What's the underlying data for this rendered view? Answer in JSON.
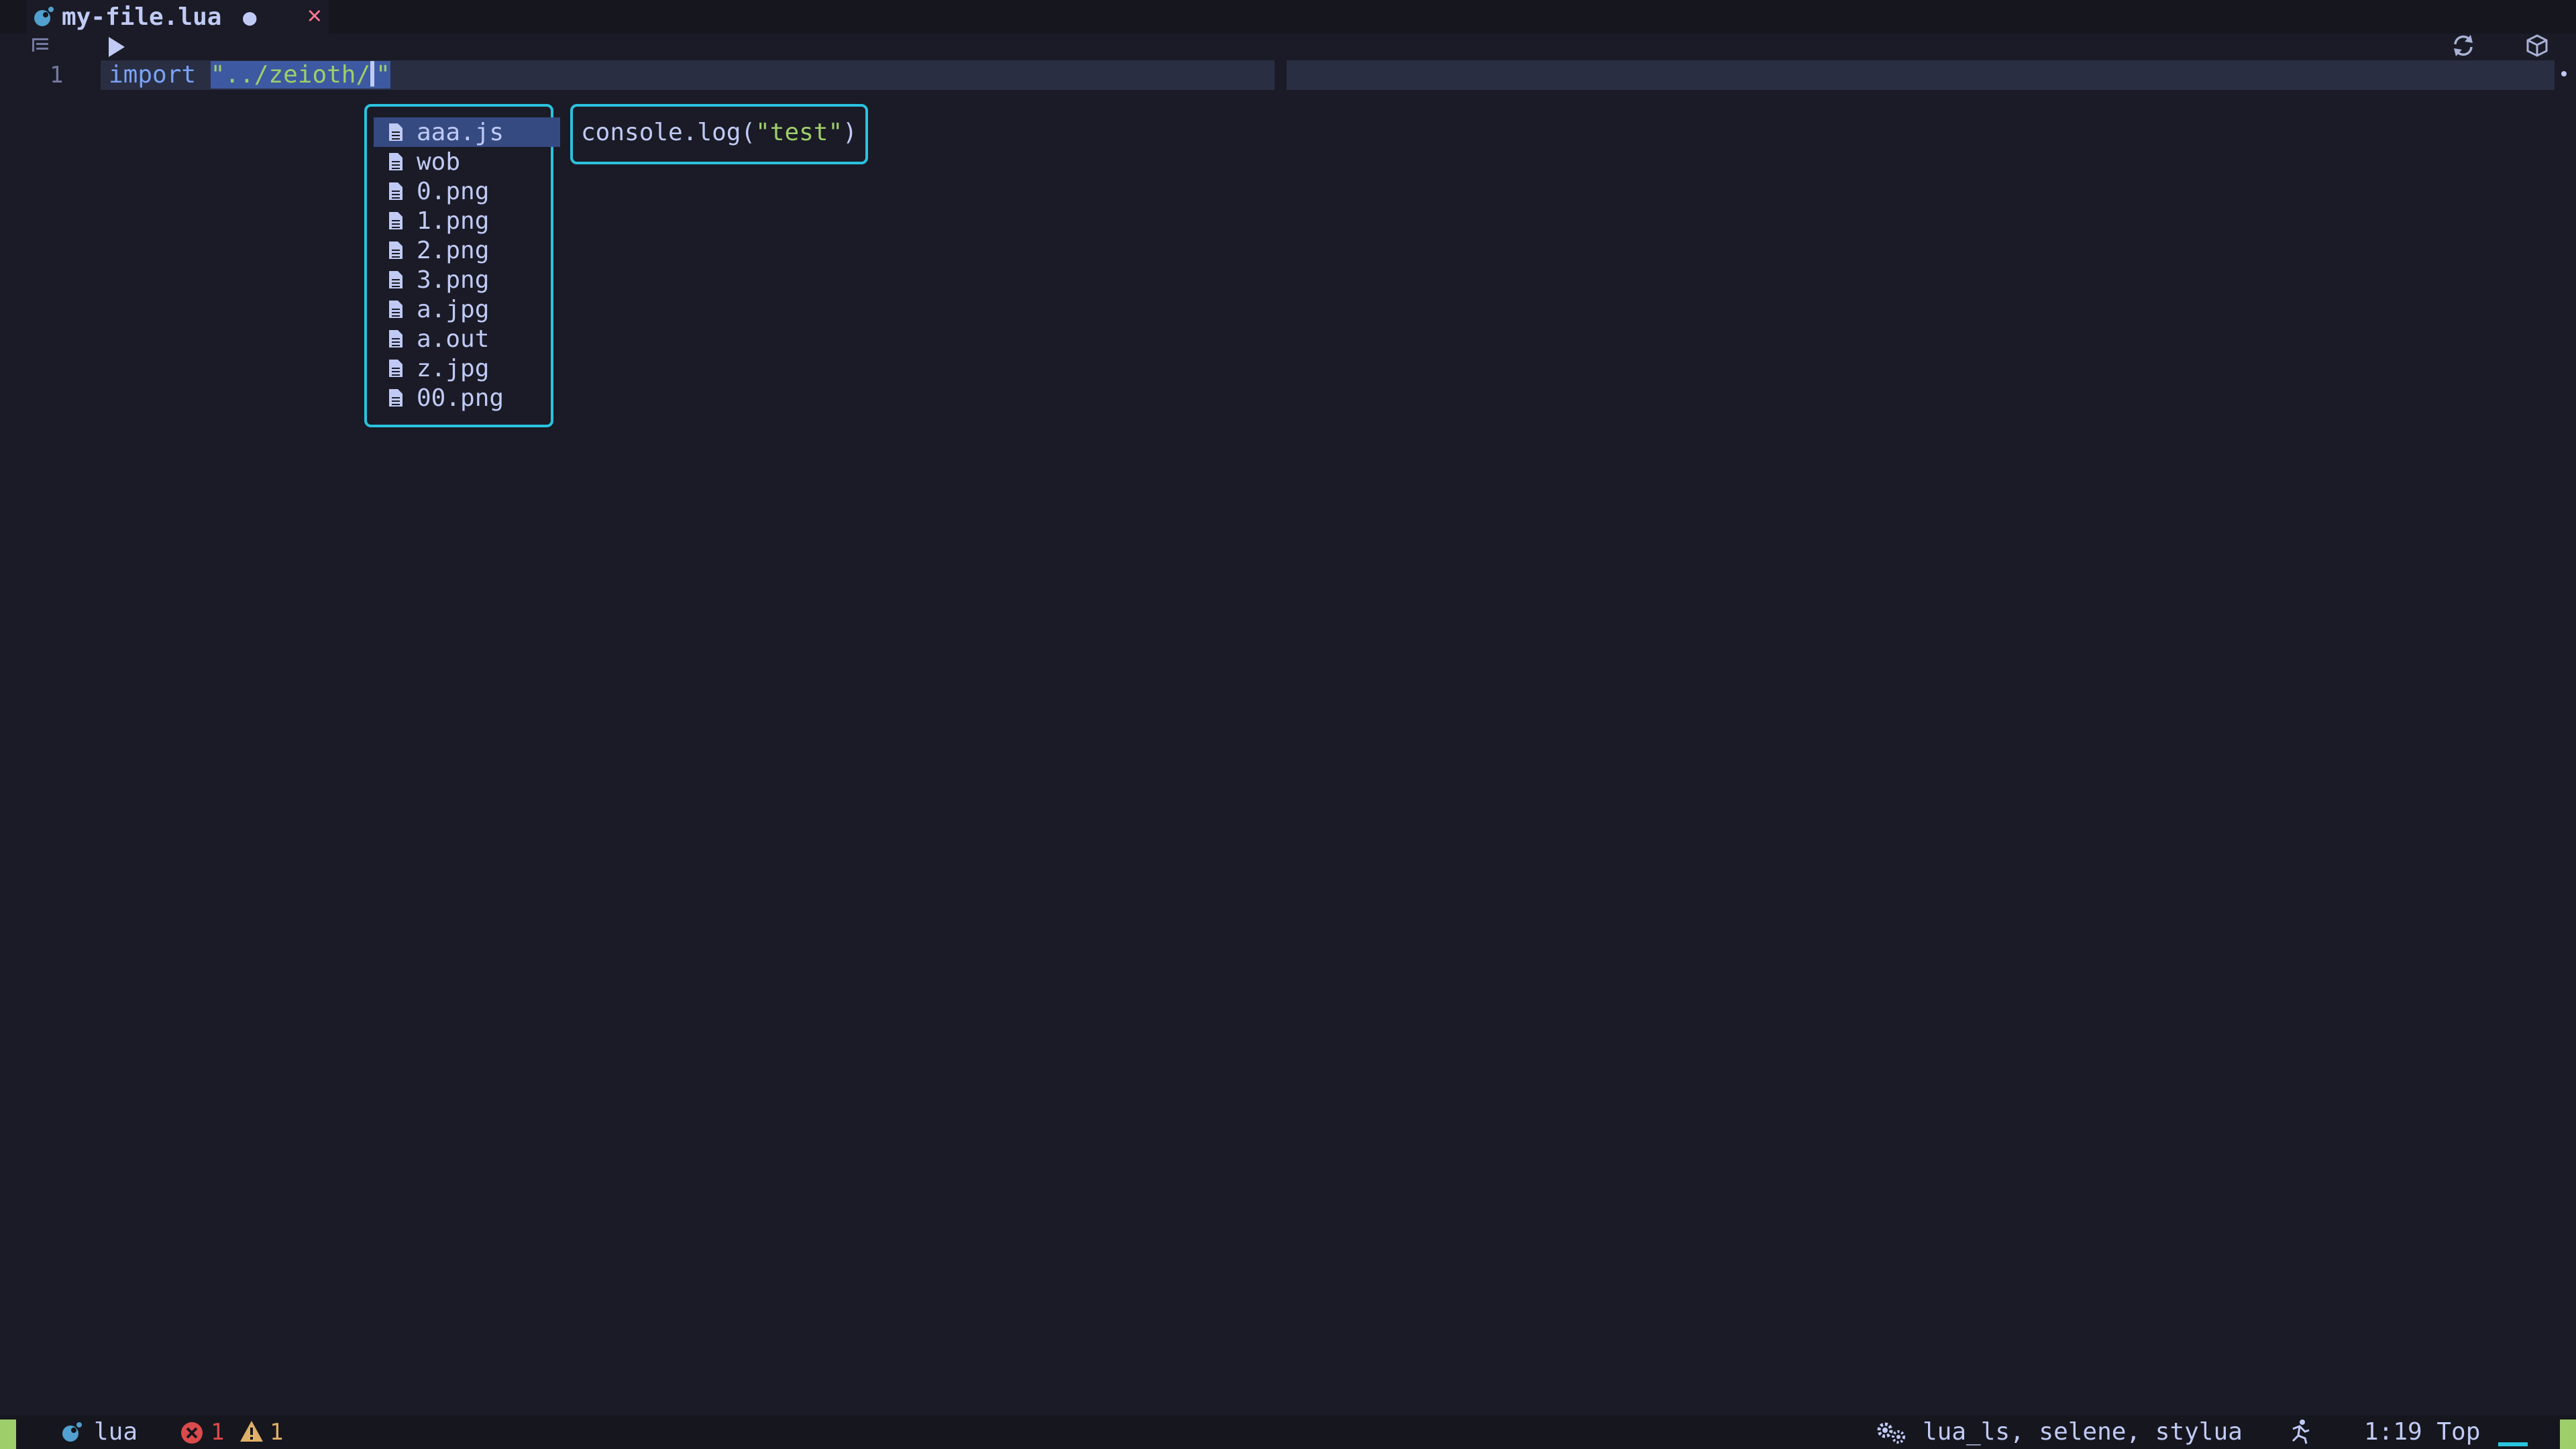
{
  "tab": {
    "title": "my-file.lua",
    "modified_indicator": "●",
    "close": "✕",
    "icon": "lua-icon"
  },
  "winbar": {
    "icons": [
      "outline-icon",
      "play-icon",
      "refresh-icon",
      "package-icon"
    ]
  },
  "editor": {
    "line_number": "1",
    "keyword": "import",
    "string_before_cursor": "\"../zeioth/",
    "string_after_cursor": "\""
  },
  "completion": {
    "items": [
      {
        "label": "aaa.js",
        "icon": "file-icon",
        "selected": true
      },
      {
        "label": "wob",
        "icon": "file-icon",
        "selected": false
      },
      {
        "label": "0.png",
        "icon": "file-icon",
        "selected": false
      },
      {
        "label": "1.png",
        "icon": "file-icon",
        "selected": false
      },
      {
        "label": "2.png",
        "icon": "file-icon",
        "selected": false
      },
      {
        "label": "3.png",
        "icon": "file-icon",
        "selected": false
      },
      {
        "label": "a.jpg",
        "icon": "file-icon",
        "selected": false
      },
      {
        "label": "a.out",
        "icon": "file-icon",
        "selected": false
      },
      {
        "label": "z.jpg",
        "icon": "file-icon",
        "selected": false
      },
      {
        "label": "00.png",
        "icon": "file-icon",
        "selected": false
      }
    ]
  },
  "doc": {
    "prefix": "console.log(",
    "string": "\"test\"",
    "suffix": ")"
  },
  "statusline": {
    "filetype": "lua",
    "errors": "1",
    "warnings": "1",
    "lsp_clients": "lua_ls, selene, stylua",
    "position": "1:19 Top"
  },
  "colors": {
    "background": "#1a1b26",
    "accent_border": "#2ac3de",
    "mode_indicator": "#9ece6a",
    "error": "#db4b4b",
    "warning": "#e0af68",
    "keyword": "#7aa2f7",
    "string": "#9ece6a"
  }
}
